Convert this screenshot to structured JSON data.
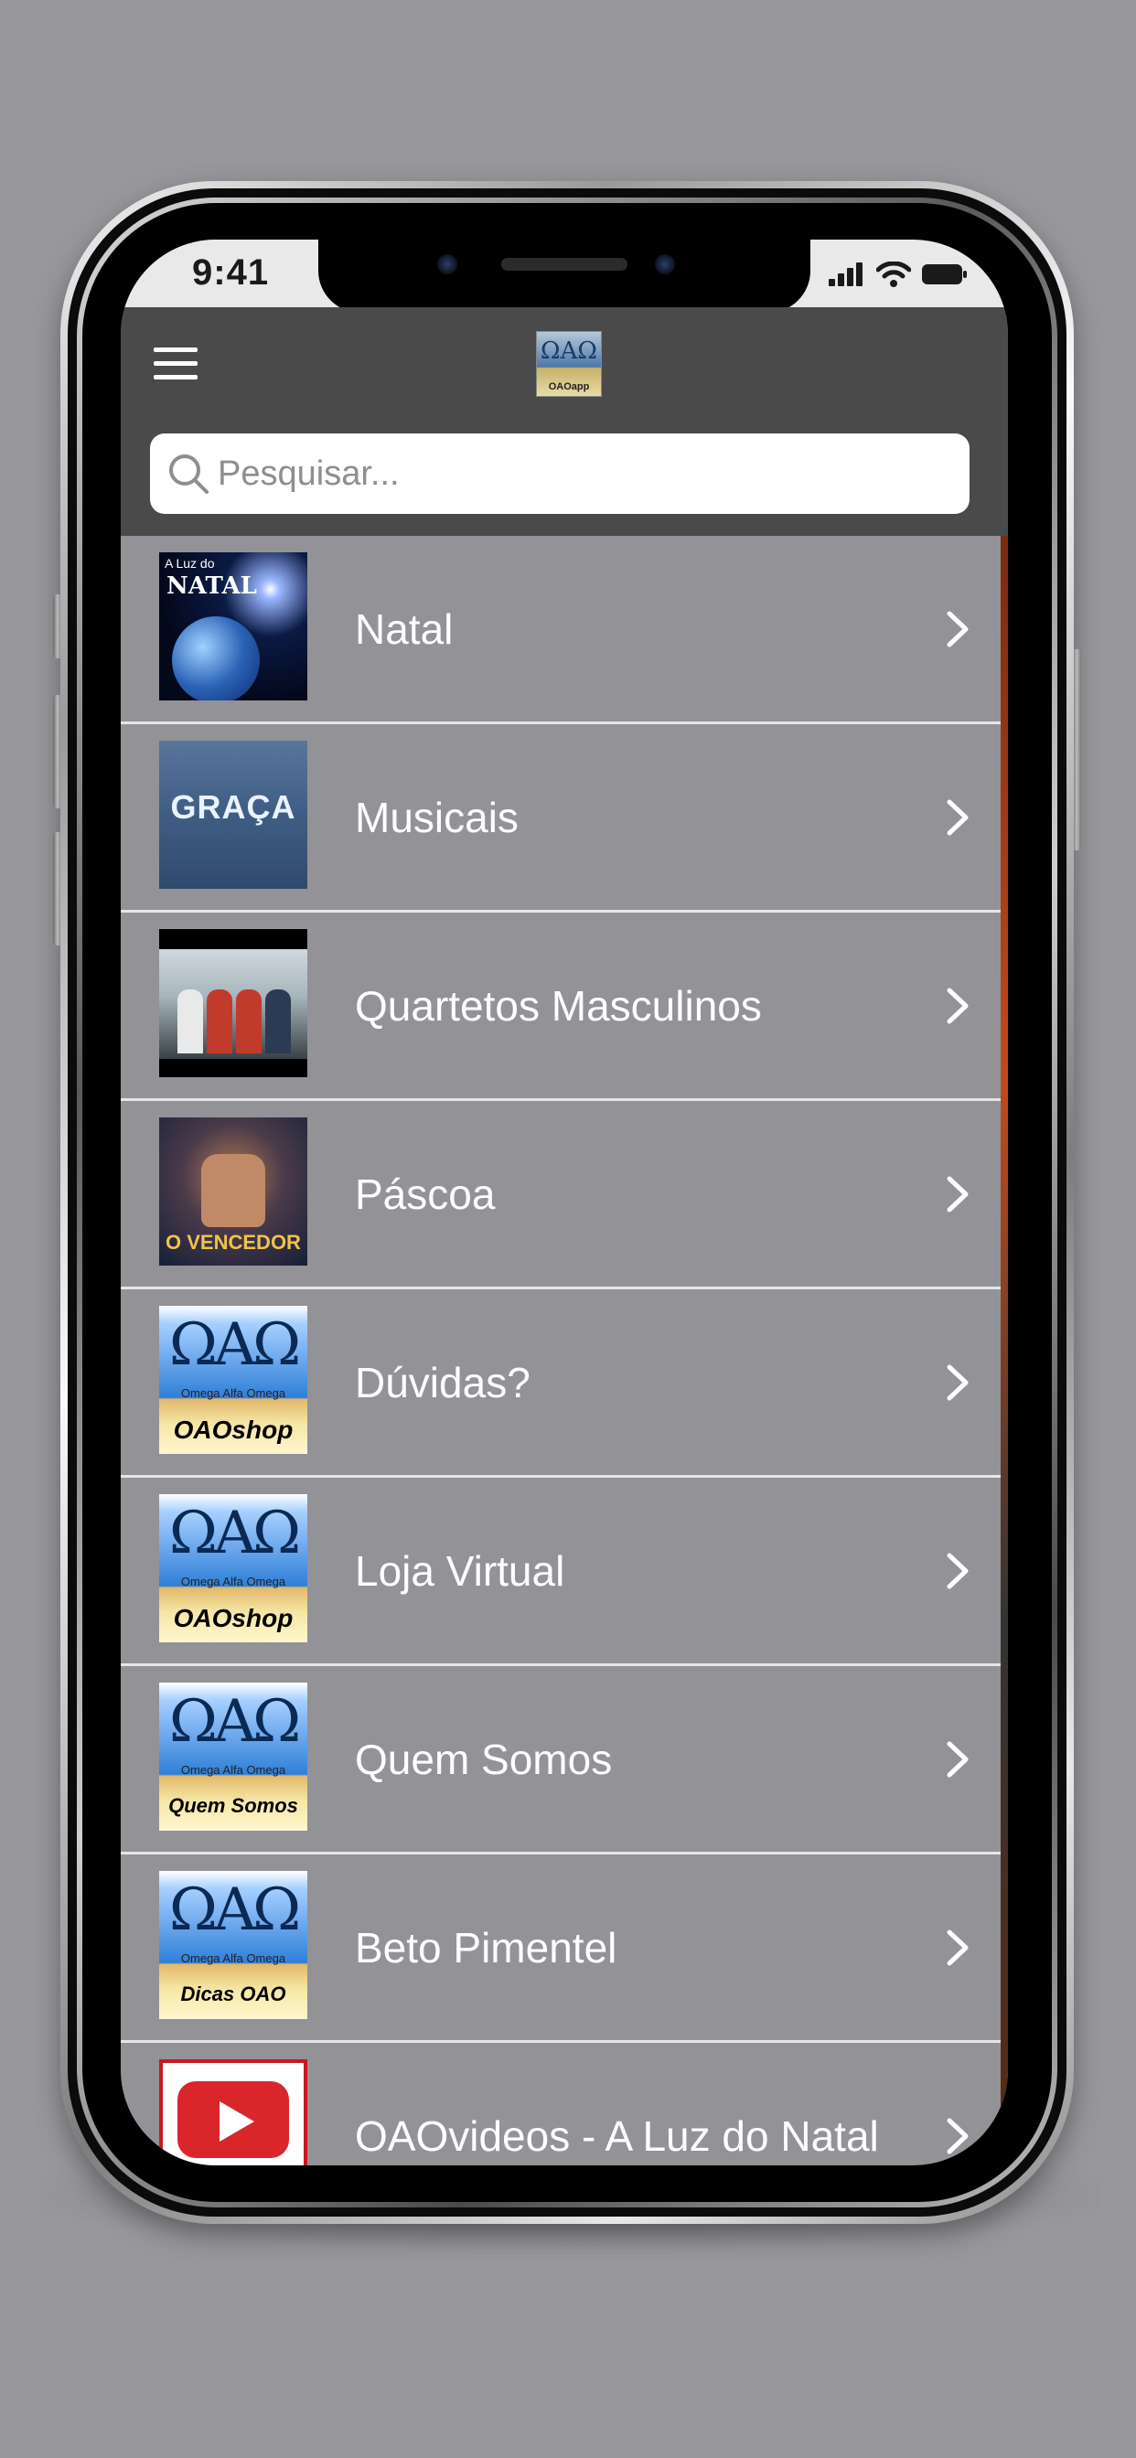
{
  "status_bar": {
    "time": "9:41"
  },
  "header": {
    "app_logo_label": "OAOapp",
    "app_logo_symbol": "ΩAΩ"
  },
  "search": {
    "placeholder": "Pesquisar...",
    "value": ""
  },
  "list": {
    "items": [
      {
        "label": "Natal",
        "thumb_line1": "A Luz do",
        "thumb_line2": "NATAL"
      },
      {
        "label": "Musicais",
        "thumb_text": "GRAÇA"
      },
      {
        "label": "Quartetos Masculinos"
      },
      {
        "label": "Páscoa",
        "thumb_text": "O VENCEDOR"
      },
      {
        "label": "Dúvidas?",
        "thumb_symbol": "ΩAΩ",
        "thumb_sub": "Omega Alfa Omega",
        "thumb_label": "OAOshop"
      },
      {
        "label": "Loja Virtual",
        "thumb_symbol": "ΩAΩ",
        "thumb_sub": "Omega Alfa Omega",
        "thumb_label": "OAOshop"
      },
      {
        "label": "Quem Somos",
        "thumb_symbol": "ΩAΩ",
        "thumb_sub": "Omega Alfa Omega",
        "thumb_label": "Quem Somos"
      },
      {
        "label": "Beto Pimentel",
        "thumb_symbol": "ΩAΩ",
        "thumb_sub": "Omega Alfa Omega",
        "thumb_label": "Dicas OAO"
      },
      {
        "label": "OAOvideos - A Luz do Natal"
      }
    ]
  },
  "colors": {
    "background": "#98979c",
    "header": "#4a4a4a",
    "list_bg": "#939297",
    "status_bar": "#e9e9e9"
  }
}
